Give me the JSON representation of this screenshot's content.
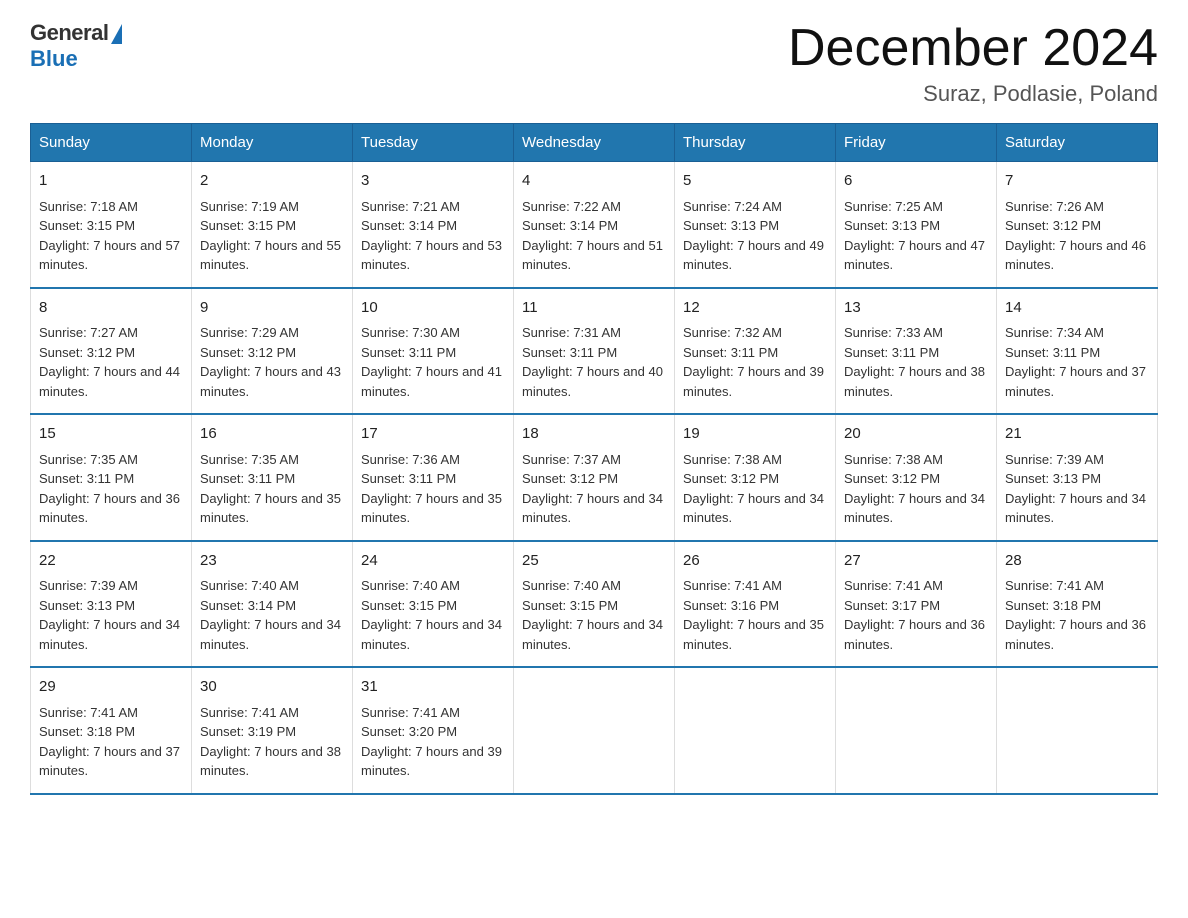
{
  "header": {
    "logo_general": "General",
    "logo_blue": "Blue",
    "month_title": "December 2024",
    "location": "Suraz, Podlasie, Poland"
  },
  "days_of_week": [
    "Sunday",
    "Monday",
    "Tuesday",
    "Wednesday",
    "Thursday",
    "Friday",
    "Saturday"
  ],
  "weeks": [
    [
      {
        "day": "1",
        "sunrise": "7:18 AM",
        "sunset": "3:15 PM",
        "daylight": "7 hours and 57 minutes."
      },
      {
        "day": "2",
        "sunrise": "7:19 AM",
        "sunset": "3:15 PM",
        "daylight": "7 hours and 55 minutes."
      },
      {
        "day": "3",
        "sunrise": "7:21 AM",
        "sunset": "3:14 PM",
        "daylight": "7 hours and 53 minutes."
      },
      {
        "day": "4",
        "sunrise": "7:22 AM",
        "sunset": "3:14 PM",
        "daylight": "7 hours and 51 minutes."
      },
      {
        "day": "5",
        "sunrise": "7:24 AM",
        "sunset": "3:13 PM",
        "daylight": "7 hours and 49 minutes."
      },
      {
        "day": "6",
        "sunrise": "7:25 AM",
        "sunset": "3:13 PM",
        "daylight": "7 hours and 47 minutes."
      },
      {
        "day": "7",
        "sunrise": "7:26 AM",
        "sunset": "3:12 PM",
        "daylight": "7 hours and 46 minutes."
      }
    ],
    [
      {
        "day": "8",
        "sunrise": "7:27 AM",
        "sunset": "3:12 PM",
        "daylight": "7 hours and 44 minutes."
      },
      {
        "day": "9",
        "sunrise": "7:29 AM",
        "sunset": "3:12 PM",
        "daylight": "7 hours and 43 minutes."
      },
      {
        "day": "10",
        "sunrise": "7:30 AM",
        "sunset": "3:11 PM",
        "daylight": "7 hours and 41 minutes."
      },
      {
        "day": "11",
        "sunrise": "7:31 AM",
        "sunset": "3:11 PM",
        "daylight": "7 hours and 40 minutes."
      },
      {
        "day": "12",
        "sunrise": "7:32 AM",
        "sunset": "3:11 PM",
        "daylight": "7 hours and 39 minutes."
      },
      {
        "day": "13",
        "sunrise": "7:33 AM",
        "sunset": "3:11 PM",
        "daylight": "7 hours and 38 minutes."
      },
      {
        "day": "14",
        "sunrise": "7:34 AM",
        "sunset": "3:11 PM",
        "daylight": "7 hours and 37 minutes."
      }
    ],
    [
      {
        "day": "15",
        "sunrise": "7:35 AM",
        "sunset": "3:11 PM",
        "daylight": "7 hours and 36 minutes."
      },
      {
        "day": "16",
        "sunrise": "7:35 AM",
        "sunset": "3:11 PM",
        "daylight": "7 hours and 35 minutes."
      },
      {
        "day": "17",
        "sunrise": "7:36 AM",
        "sunset": "3:11 PM",
        "daylight": "7 hours and 35 minutes."
      },
      {
        "day": "18",
        "sunrise": "7:37 AM",
        "sunset": "3:12 PM",
        "daylight": "7 hours and 34 minutes."
      },
      {
        "day": "19",
        "sunrise": "7:38 AM",
        "sunset": "3:12 PM",
        "daylight": "7 hours and 34 minutes."
      },
      {
        "day": "20",
        "sunrise": "7:38 AM",
        "sunset": "3:12 PM",
        "daylight": "7 hours and 34 minutes."
      },
      {
        "day": "21",
        "sunrise": "7:39 AM",
        "sunset": "3:13 PM",
        "daylight": "7 hours and 34 minutes."
      }
    ],
    [
      {
        "day": "22",
        "sunrise": "7:39 AM",
        "sunset": "3:13 PM",
        "daylight": "7 hours and 34 minutes."
      },
      {
        "day": "23",
        "sunrise": "7:40 AM",
        "sunset": "3:14 PM",
        "daylight": "7 hours and 34 minutes."
      },
      {
        "day": "24",
        "sunrise": "7:40 AM",
        "sunset": "3:15 PM",
        "daylight": "7 hours and 34 minutes."
      },
      {
        "day": "25",
        "sunrise": "7:40 AM",
        "sunset": "3:15 PM",
        "daylight": "7 hours and 34 minutes."
      },
      {
        "day": "26",
        "sunrise": "7:41 AM",
        "sunset": "3:16 PM",
        "daylight": "7 hours and 35 minutes."
      },
      {
        "day": "27",
        "sunrise": "7:41 AM",
        "sunset": "3:17 PM",
        "daylight": "7 hours and 36 minutes."
      },
      {
        "day": "28",
        "sunrise": "7:41 AM",
        "sunset": "3:18 PM",
        "daylight": "7 hours and 36 minutes."
      }
    ],
    [
      {
        "day": "29",
        "sunrise": "7:41 AM",
        "sunset": "3:18 PM",
        "daylight": "7 hours and 37 minutes."
      },
      {
        "day": "30",
        "sunrise": "7:41 AM",
        "sunset": "3:19 PM",
        "daylight": "7 hours and 38 minutes."
      },
      {
        "day": "31",
        "sunrise": "7:41 AM",
        "sunset": "3:20 PM",
        "daylight": "7 hours and 39 minutes."
      },
      null,
      null,
      null,
      null
    ]
  ]
}
